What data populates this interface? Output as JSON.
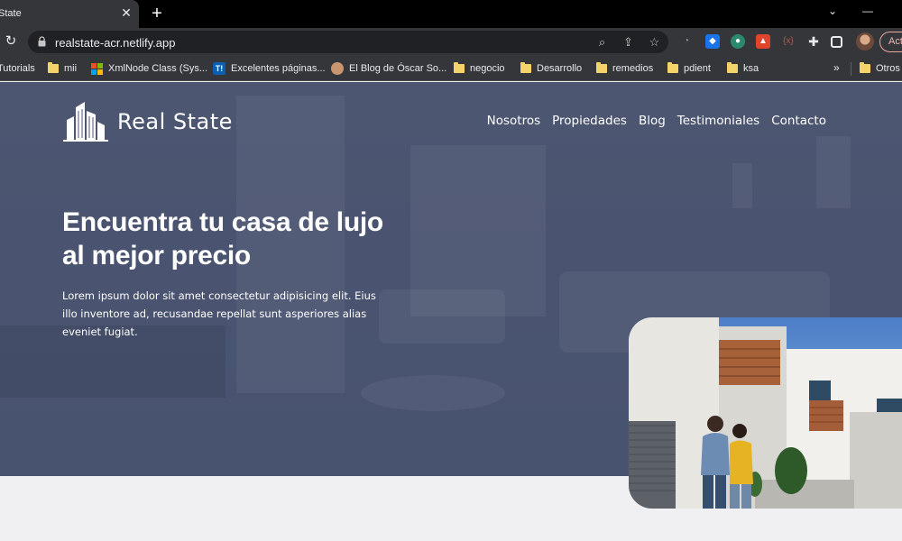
{
  "browser": {
    "tab_title": "State",
    "tab_close": "✕",
    "new_tab": "+",
    "url": "realstate-acr.netlify.app",
    "action_button": "Act",
    "bookmarks": [
      {
        "label": "Tutorials",
        "icon": "none"
      },
      {
        "label": "mii",
        "icon": "folder-icon"
      },
      {
        "label": "XmlNode Class (Sys...",
        "icon": "microsoft-icon"
      },
      {
        "label": "Excelentes páginas...",
        "icon": "trello-icon"
      },
      {
        "label": "El Blog de Óscar So...",
        "icon": "avatar-icon"
      },
      {
        "label": "negocio",
        "icon": "folder-icon"
      },
      {
        "label": "Desarrollo",
        "icon": "folder-icon"
      },
      {
        "label": "remedios",
        "icon": "folder-icon"
      },
      {
        "label": "pdient",
        "icon": "folder-icon"
      },
      {
        "label": "ksa",
        "icon": "folder-icon"
      }
    ],
    "bookmarks_more": "»",
    "other_bookmarks": "Otros"
  },
  "site": {
    "logo_text": "Real State",
    "nav": [
      "Nosotros",
      "Propiedades",
      "Blog",
      "Testimoniales",
      "Contacto"
    ],
    "hero_title_line1": "Encuentra tu casa de lujo",
    "hero_title_line2": "al mejor precio",
    "hero_text": "Lorem ipsum dolor sit amet consectetur adipisicing elit. Eius illo inventore ad, recusandae repellat sunt asperiores alias eveniet fugiat."
  },
  "colors": {
    "hero_overlay": "#4a5470",
    "page_bg": "#f0f0f3",
    "browser_dark": "#35363a"
  }
}
